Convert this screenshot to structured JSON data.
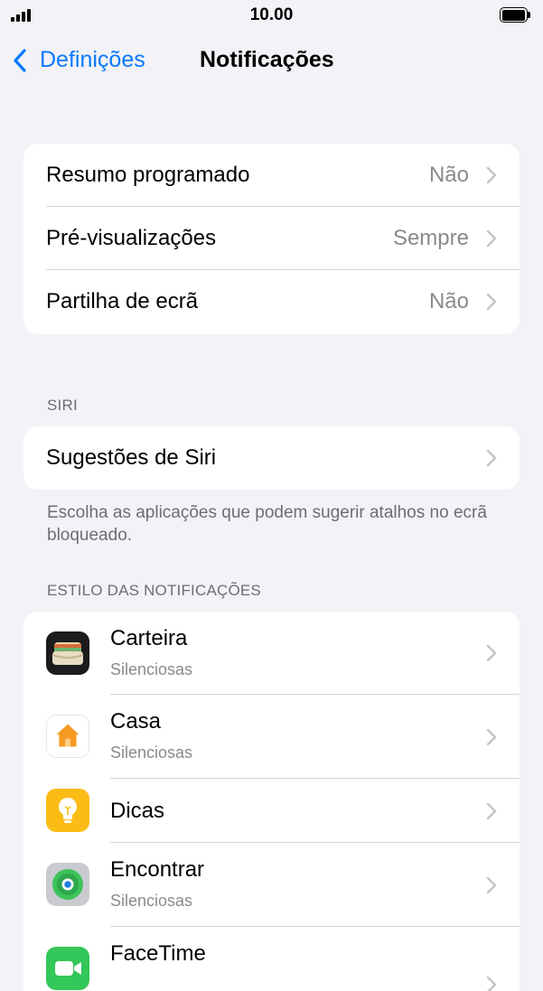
{
  "status_bar": {
    "time": "10.00"
  },
  "nav": {
    "back_label": "Definições",
    "title": "Notificações"
  },
  "general": [
    {
      "label": "Resumo programado",
      "value": "Não"
    },
    {
      "label": "Pré-visualizações",
      "value": "Sempre"
    },
    {
      "label": "Partilha de ecrã",
      "value": "Não"
    }
  ],
  "siri": {
    "header": "SIRI",
    "row_label": "Sugestões de Siri",
    "footer": "Escolha as aplicações que podem sugerir atalhos no ecrã bloqueado."
  },
  "notification_style": {
    "header": "ESTILO DAS NOTIFICAÇÕES",
    "apps": [
      {
        "name": "Carteira",
        "subtitle": "Silenciosas",
        "icon": "wallet-icon"
      },
      {
        "name": "Casa",
        "subtitle": "Silenciosas",
        "icon": "home-icon"
      },
      {
        "name": "Dicas",
        "subtitle": "",
        "icon": "tips-icon"
      },
      {
        "name": "Encontrar",
        "subtitle": "Silenciosas",
        "icon": "find-my-icon"
      },
      {
        "name": "FaceTime",
        "subtitle": "",
        "icon": "facetime-icon"
      }
    ]
  },
  "colors": {
    "accent": "#0a7aff",
    "background": "#f2f2f7",
    "secondary_text": "#8a8a8e"
  }
}
